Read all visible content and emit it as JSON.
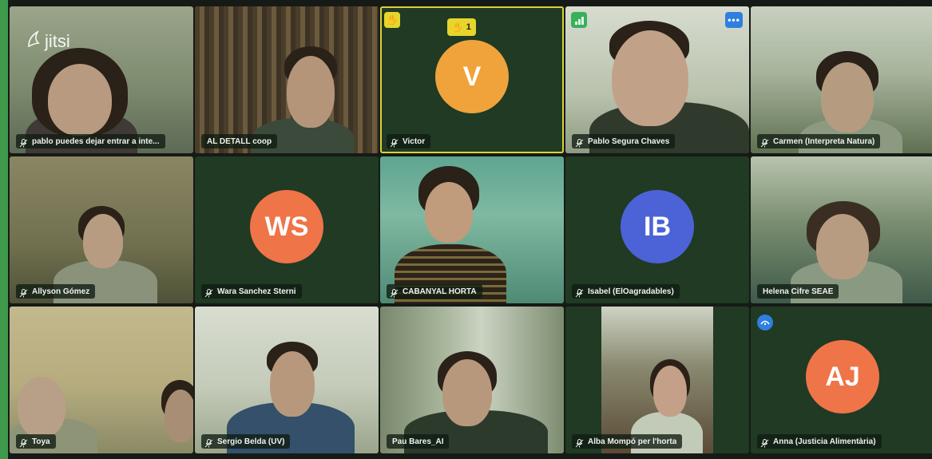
{
  "app": {
    "brand": "jitsi"
  },
  "raised_hands": {
    "count": "1"
  },
  "colors": {
    "tile_bg": "#203a24",
    "active_border": "#4aa8d8",
    "raised_border": "#d9d23a",
    "avatar_v": "#f0a33a",
    "avatar_ws": "#ef7448",
    "avatar_ib": "#4b63d6",
    "avatar_aj": "#ef7448"
  },
  "participants": [
    {
      "name": "pablo puedes dejar entrar a inte...",
      "type": "video"
    },
    {
      "name": "AL DETALL coop",
      "type": "video",
      "active_speaker": true
    },
    {
      "name": "Victor",
      "type": "avatar",
      "initials": "V",
      "hand_raised": true
    },
    {
      "name": "Pablo Segura Chaves",
      "type": "video"
    },
    {
      "name": "Carmen (Interpreta Natura)",
      "type": "video"
    },
    {
      "name": "Allyson Gómez",
      "type": "video"
    },
    {
      "name": "Wara Sanchez Sterni",
      "type": "avatar",
      "initials": "WS"
    },
    {
      "name": "CABANYAL HORTA",
      "type": "video"
    },
    {
      "name": "Isabel (ElOagradables)",
      "type": "avatar",
      "initials": "IB"
    },
    {
      "name": "Helena Cifre SEAE",
      "type": "video"
    },
    {
      "name": "Toya",
      "type": "video"
    },
    {
      "name": "Sergio Belda (UV)",
      "type": "video"
    },
    {
      "name": "Pau Bares_AI",
      "type": "video"
    },
    {
      "name": "Alba Mompó per l'horta",
      "type": "video"
    },
    {
      "name": "Anna (Justicia Alimentària)",
      "type": "avatar",
      "initials": "AJ"
    }
  ],
  "icons": {
    "mic": "mic-icon",
    "hand": "raised-hand-icon",
    "signal": "connection-signal-icon",
    "more": "more-options-icon",
    "brand": "jitsi-logo-icon"
  }
}
